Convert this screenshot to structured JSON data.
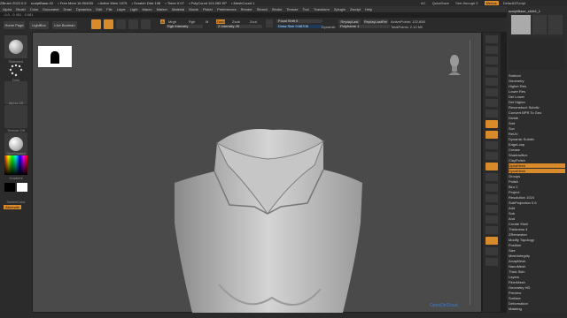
{
  "titlebar": {
    "items": [
      "ZBrush 2022.0.5",
      "sculptBase-02",
      "• Free Mem 16.904GB",
      "• Active Mem 1575",
      "• Scratch Disk 198",
      "• Timer 0.07",
      "• PolyCount 124.265 KP",
      "• MeshCount 1"
    ],
    "right": [
      "AC",
      "QuickSave",
      "See-through 0",
      "Menus",
      "DefaultZScript"
    ]
  },
  "menu": [
    "Alpha",
    "Brush",
    "Color",
    "Document",
    "Draw",
    "Dynamics",
    "Edit",
    "File",
    "Layer",
    "Light",
    "Macro",
    "Marker",
    "Material",
    "Movie",
    "Picker",
    "Preferences",
    "Render",
    "Stencil",
    "Stroke",
    "Texture",
    "Tool",
    "Transform",
    "Zplugin",
    "Zscript",
    "Help"
  ],
  "coords": "-0.0 , 0.451 , 0.081",
  "topbar": {
    "home_page": "Home Page",
    "lightbox": "LightBox",
    "live_boolean": "Live Boolean",
    "edit": "Edit",
    "draw": "Draw",
    "move": "Move",
    "scale": "Scale",
    "rotate": "Rotate",
    "a_label": "A",
    "mrgb": "Mrgb",
    "rgb": "Rgb",
    "m": "M",
    "zadd": "Zadd",
    "zsub": "Zsub",
    "zcut": "Zcut",
    "rgb_intensity": "Rgb Intensity",
    "z_intensity": "Z Intensity 25",
    "focal_shift": "Focal Shift 0",
    "draw_size": "Draw Size 9.68708",
    "dynamic": "Dynamic",
    "replay_last": "ReplayLast",
    "replay_last_rel": "ReplayLastRel",
    "polyframe": "Polyframe 1",
    "active_points": "ActivePoints: 122,858",
    "total_points": "TotalPoints: 2.10 Mil"
  },
  "leftpanel": {
    "brush_label": "Standard",
    "stroke_label": "Dots",
    "alpha_label": "Alpha Off",
    "texture_label": "Texture Off",
    "material_label": "SkinShade4",
    "gradient": "Gradient",
    "switch_color": "SwitchColor",
    "alternate": "Alternate"
  },
  "rightpanel": {
    "thumb_label": "sculptBase_shirt4_1",
    "tools": [
      "Female_shirt4_1",
      "Cylinder3D",
      "SimpleBrush",
      "PolyMesh3D",
      "Female_shirt4_1",
      "Female_shirt4_1"
    ],
    "sections": [
      "Subtool",
      "Geometry",
      "Higher Res",
      "Lower Res",
      "Del Lower",
      "Del Higher",
      "Reconstruct Subdiv",
      "Convert BPR To Geo",
      "Divide",
      "Smt",
      "Suv",
      "ReUV",
      "Dynamic Subdiv",
      "EdgeLoop",
      "Crease",
      "ShadowBox",
      "ClayPolish",
      "DynaMesh",
      "DynaMesh",
      "Groups",
      "Polish",
      "Blur 2",
      "Project",
      "Resolution 1024",
      "SubProjection 0.6",
      "Add",
      "Sub",
      "And",
      "Create Shell",
      "Thickness 4",
      "ZRemesher",
      "Modify Topology",
      "Position",
      "Size",
      "MeshIntegrity",
      "ArrayMesh",
      "NanoMesh",
      "Thick Skin",
      "Layers",
      "FiberMesh",
      "Geometry HD",
      "Preview",
      "Surface",
      "Deformation",
      "Masking",
      "Visibility"
    ]
  },
  "viewport": {
    "watermark": "OpenDirCloud"
  },
  "colors": {
    "accent": "#d98a2a",
    "bg": "#1f1f1f",
    "viewport": "#4a4a4a"
  }
}
